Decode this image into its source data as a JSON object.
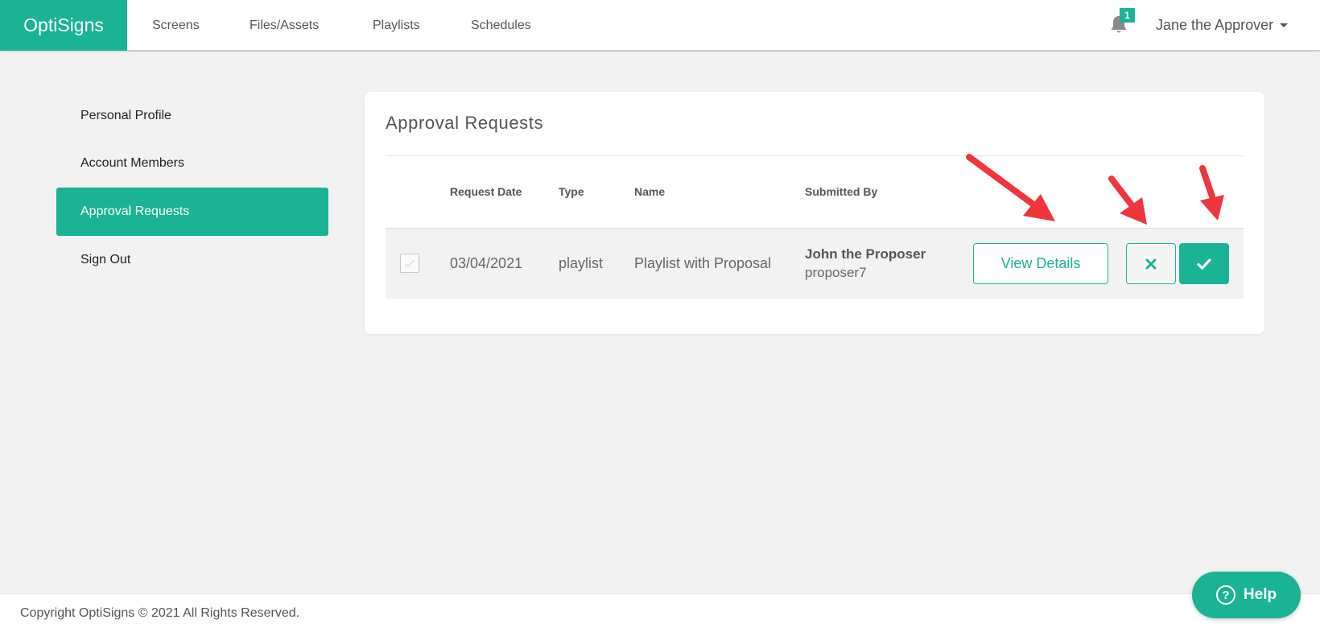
{
  "nav": {
    "brand": "OptiSigns",
    "links": [
      "Screens",
      "Files/Assets",
      "Playlists",
      "Schedules"
    ],
    "notification_count": "1",
    "user_name": "Jane the Approver"
  },
  "sidebar": {
    "items": [
      {
        "label": "Personal Profile"
      },
      {
        "label": "Account Members"
      },
      {
        "label": "Approval Requests"
      },
      {
        "label": "Sign Out"
      }
    ],
    "active": "Approval Requests"
  },
  "main": {
    "title": "Approval Requests",
    "columns": [
      "Request Date",
      "Type",
      "Name",
      "Submitted By"
    ],
    "rows": [
      {
        "request_date": "03/04/2021",
        "type": "playlist",
        "name": "Playlist with Proposal",
        "submitted_by_name": "John the Proposer",
        "submitted_by_user": "proposer7",
        "view_label": "View Details"
      }
    ]
  },
  "footer": {
    "copyright": "Copyright OptiSigns © 2021 All Rights Reserved.",
    "help_label": "Help"
  },
  "colors": {
    "accent": "#1ab394",
    "annotation_arrow": "#f0353c",
    "background": "#f2f2f2"
  },
  "icons": {
    "notifications": "bell-icon",
    "reject": "x-icon",
    "approve": "check-icon",
    "help": "question-circle-icon"
  }
}
